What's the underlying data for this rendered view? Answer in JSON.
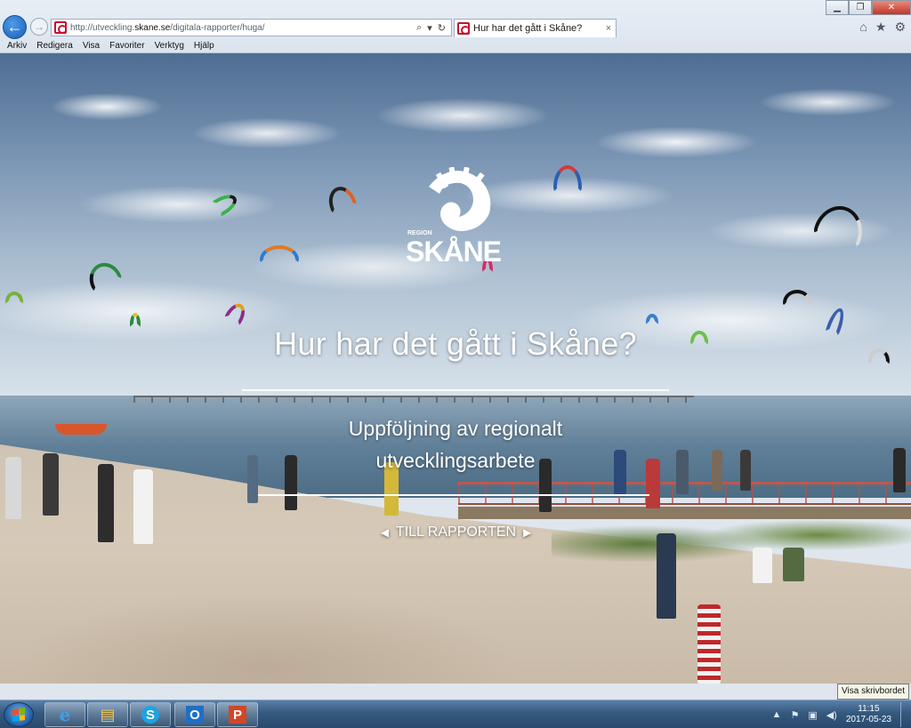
{
  "browser": {
    "url_prefix": "http://utveckling.",
    "url_domain": "skane.se",
    "url_path": "/digitala-rapporter/huga/",
    "tab_title": "Hur har det gått i Skåne?",
    "tab_close": "×",
    "back_icon": "←",
    "forward_icon": "→",
    "search_icon": "⌕",
    "dropdown_icon": "▾",
    "refresh_icon": "↻",
    "home_icon": "⌂",
    "favorites_icon": "★",
    "tools_icon": "⚙",
    "minimize": "▁",
    "restore": "❐",
    "close": "✕"
  },
  "menu": [
    "Arkiv",
    "Redigera",
    "Visa",
    "Favoriter",
    "Verktyg",
    "Hjälp"
  ],
  "page": {
    "logo_small": "REGION",
    "logo_big": "SKÅNE",
    "title": "Hur har det gått i Skåne?",
    "subtitle": "Uppföljning av regionalt utvecklingsarbete",
    "cta": "TILL RAPPORTEN",
    "cta_left": "◀",
    "cta_right": "▶"
  },
  "tooltip": "Visa skrivbordet",
  "taskbar": {
    "apps": [
      {
        "name": "internet-explorer",
        "glyph": "e",
        "color": "#3fa0e8"
      },
      {
        "name": "file-explorer",
        "glyph": "▤",
        "color": "#f0c24a"
      },
      {
        "name": "skype",
        "glyph": "S",
        "color": "#1ea3e0"
      },
      {
        "name": "outlook",
        "glyph": "O",
        "color": "#1f6fc4"
      },
      {
        "name": "powerpoint",
        "glyph": "P",
        "color": "#d24726"
      }
    ],
    "tray_icons": [
      "▲",
      "⚑",
      "▣",
      "◀)"
    ],
    "time": "11:15",
    "date": "2017-05-23"
  },
  "colors": {
    "brand_red": "#c8102e",
    "ie_blue": "#1a5fb4"
  }
}
